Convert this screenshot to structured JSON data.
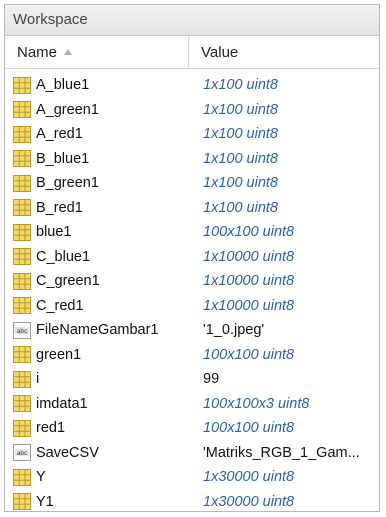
{
  "window": {
    "title": "Workspace"
  },
  "columns": {
    "name": "Name",
    "value": "Value"
  },
  "icons": {
    "matrix": "matrix-grid-icon",
    "text": "string-abc-icon",
    "sort": "sort-up-icon"
  },
  "colors": {
    "matrix_icon": "#e8c84a",
    "value_italic": "#2b5fa8"
  },
  "variables": [
    {
      "name": "A_blue1",
      "value": "1x100 uint8",
      "icon": "matrix",
      "style": "italic"
    },
    {
      "name": "A_green1",
      "value": "1x100 uint8",
      "icon": "matrix",
      "style": "italic"
    },
    {
      "name": "A_red1",
      "value": "1x100 uint8",
      "icon": "matrix",
      "style": "italic"
    },
    {
      "name": "B_blue1",
      "value": "1x100 uint8",
      "icon": "matrix",
      "style": "italic"
    },
    {
      "name": "B_green1",
      "value": "1x100 uint8",
      "icon": "matrix",
      "style": "italic"
    },
    {
      "name": "B_red1",
      "value": "1x100 uint8",
      "icon": "matrix",
      "style": "italic"
    },
    {
      "name": "blue1",
      "value": "100x100 uint8",
      "icon": "matrix",
      "style": "italic"
    },
    {
      "name": "C_blue1",
      "value": "1x10000 uint8",
      "icon": "matrix",
      "style": "italic"
    },
    {
      "name": "C_green1",
      "value": "1x10000 uint8",
      "icon": "matrix",
      "style": "italic"
    },
    {
      "name": "C_red1",
      "value": "1x10000 uint8",
      "icon": "matrix",
      "style": "italic"
    },
    {
      "name": "FileNameGambar1",
      "value": "'1_0.jpeg'",
      "icon": "text",
      "style": "plain"
    },
    {
      "name": "green1",
      "value": "100x100 uint8",
      "icon": "matrix",
      "style": "italic"
    },
    {
      "name": "i",
      "value": "99",
      "icon": "matrix",
      "style": "plain"
    },
    {
      "name": "imdata1",
      "value": "100x100x3 uint8",
      "icon": "matrix",
      "style": "italic"
    },
    {
      "name": "red1",
      "value": "100x100 uint8",
      "icon": "matrix",
      "style": "italic"
    },
    {
      "name": "SaveCSV",
      "value": "'Matriks_RGB_1_Gam...",
      "icon": "text",
      "style": "plain"
    },
    {
      "name": "Y",
      "value": "1x30000 uint8",
      "icon": "matrix",
      "style": "italic"
    },
    {
      "name": "Y1",
      "value": "1x30000 uint8",
      "icon": "matrix",
      "style": "italic"
    }
  ]
}
